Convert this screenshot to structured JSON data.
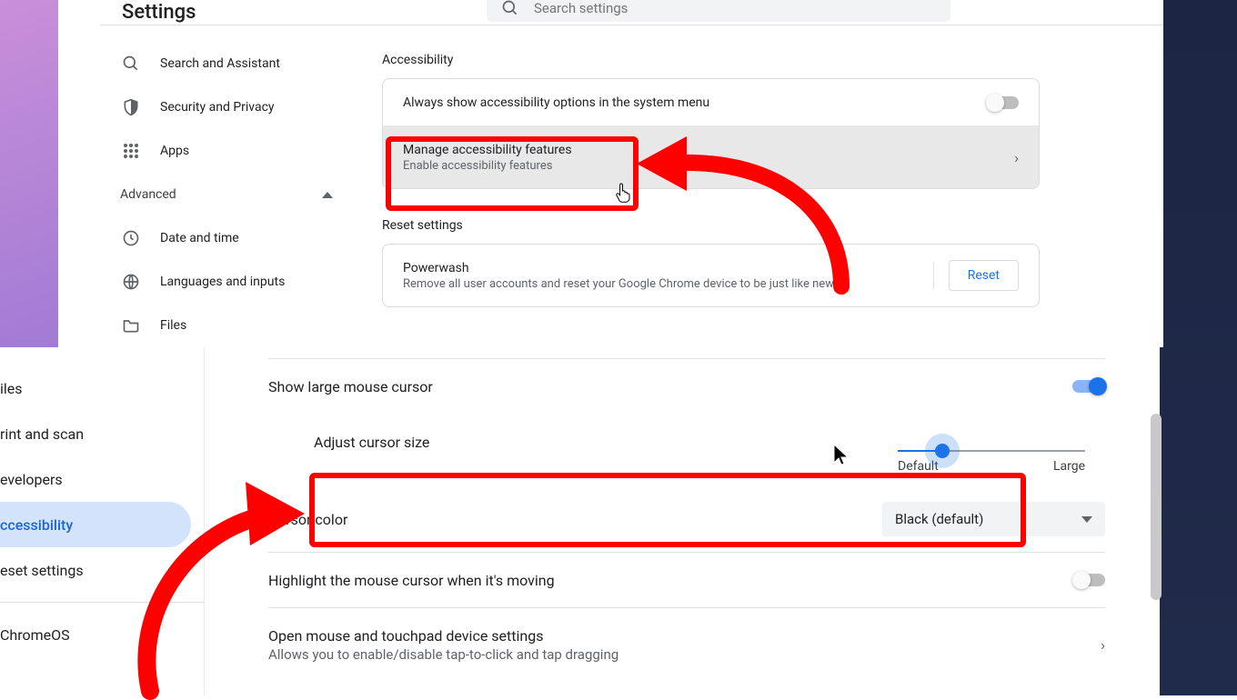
{
  "panel1": {
    "title": "Settings",
    "search_placeholder": "Search settings",
    "sidebar": {
      "items": [
        {
          "label": "Search and Assistant",
          "icon": "search-icon"
        },
        {
          "label": "Security and Privacy",
          "icon": "shield-icon"
        },
        {
          "label": "Apps",
          "icon": "apps-grid-icon"
        }
      ],
      "advanced_label": "Advanced",
      "advanced_expanded": true,
      "advanced_items": [
        {
          "label": "Date and time",
          "icon": "clock-icon"
        },
        {
          "label": "Languages and inputs",
          "icon": "globe-icon"
        },
        {
          "label": "Files",
          "icon": "folder-icon"
        }
      ]
    },
    "main": {
      "accessibility_section": "Accessibility",
      "row_always_show": "Always show accessibility options in the system menu",
      "row_manage_title": "Manage accessibility features",
      "row_manage_sub": "Enable accessibility features",
      "reset_section": "Reset settings",
      "powerwash_title": "Powerwash",
      "powerwash_sub": "Remove all user accounts and reset your Google Chrome device to be just like new.",
      "reset_button": "Reset"
    }
  },
  "panel2": {
    "sidebar": {
      "items": [
        {
          "label": "iles"
        },
        {
          "label": "rint and scan"
        },
        {
          "label": "evelopers"
        },
        {
          "label": "ccessibility",
          "active": true
        },
        {
          "label": "eset settings"
        },
        {
          "label": "ChromeOS"
        }
      ]
    },
    "main": {
      "show_large_cursor": "Show large mouse cursor",
      "adjust_cursor_size": "Adjust cursor size",
      "slider_min": "Default",
      "slider_max": "Large",
      "cursor_color_label": "Cursor color",
      "cursor_color_value": "Black (default)",
      "highlight_moving": "Highlight the mouse cursor when it's moving",
      "open_mouse_title": "Open mouse and touchpad device settings",
      "open_mouse_sub": "Allows you to enable/disable tap-to-click and tap dragging"
    }
  }
}
